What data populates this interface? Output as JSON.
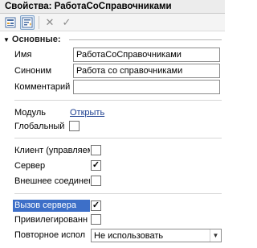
{
  "window": {
    "title": "Свойства: РаботаСоСправочниками"
  },
  "toolbar": {
    "buttons": [
      {
        "icon": "form-icon"
      },
      {
        "icon": "sort-icon"
      },
      {
        "icon": "close-icon",
        "glyph": "✕"
      },
      {
        "icon": "check-icon",
        "glyph": "✓"
      }
    ]
  },
  "section": {
    "title": "Основные:"
  },
  "fields": {
    "name": {
      "label": "Имя",
      "value": "РаботаСоСправочниками"
    },
    "synonym": {
      "label": "Синоним",
      "value": "Работа со справочниками"
    },
    "comment": {
      "label": "Комментарий",
      "value": ""
    }
  },
  "module": {
    "label": "Модуль",
    "link": "Открыть"
  },
  "flags": {
    "global": {
      "label": "Глобальный",
      "checked": false
    },
    "client_managed": {
      "label": "Клиент (управляем",
      "checked": false
    },
    "server": {
      "label": "Сервер",
      "checked": true
    },
    "external": {
      "label": "Внешнее соединен",
      "checked": false
    },
    "server_call": {
      "label": "Вызов сервера",
      "checked": true
    },
    "privileged": {
      "label": "Привилегированн",
      "checked": false
    }
  },
  "reuse": {
    "label": "Повторное испол",
    "value": "Не использовать"
  }
}
